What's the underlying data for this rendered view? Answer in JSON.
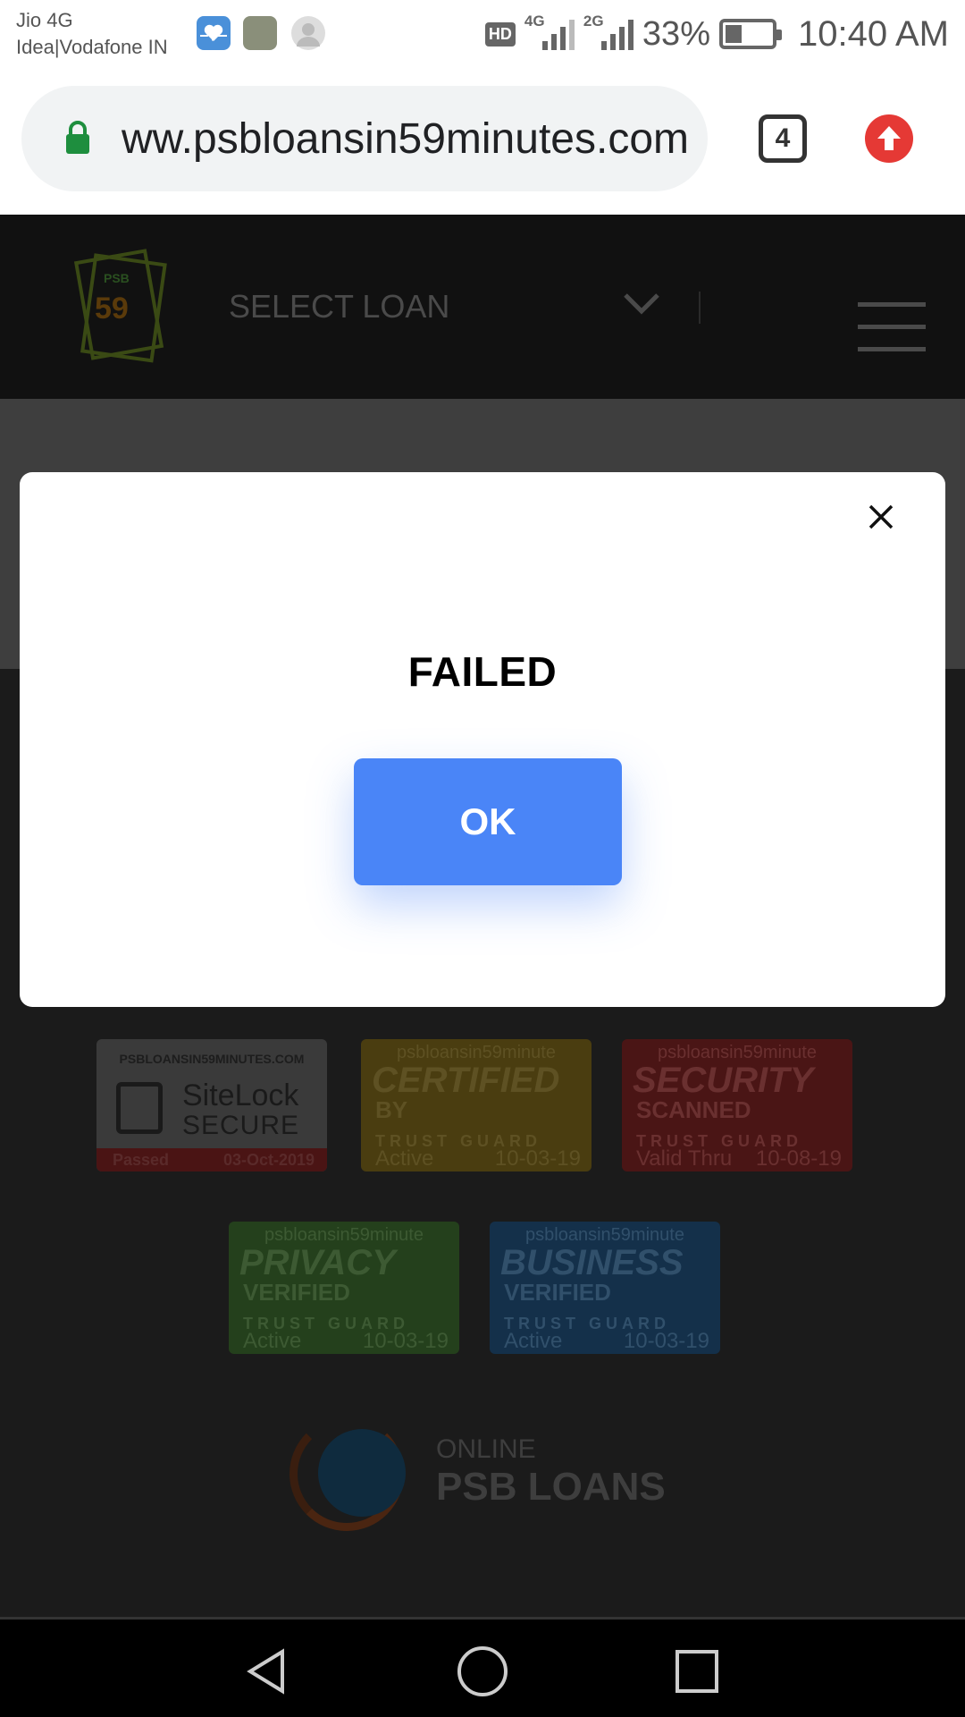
{
  "status_bar": {
    "carrier_1": "Jio 4G",
    "carrier_2": "Idea|Vodafone IN",
    "hd": "HD",
    "net_1": "4G",
    "net_2": "2G",
    "battery": "33%",
    "time": "10:40 AM"
  },
  "browser": {
    "url": "ww.psbloansin59minutes.com",
    "tab_count": "4"
  },
  "site": {
    "logo_text_small": "PSB",
    "logo_text_big": "59",
    "select_loan": "SELECT LOAN",
    "badges": {
      "sitelock": {
        "header": "PSBLOANSIN59MINUTES.COM",
        "line1": "SiteLock",
        "line2": "SECURE",
        "status": "Passed",
        "date": "03-Oct-2019"
      },
      "certified": {
        "top": "psbloansin59minute",
        "big": "CERTIFIED",
        "mid": "BY",
        "tg": "TRUST GUARD",
        "status": "Active",
        "date": "10-03-19"
      },
      "security": {
        "top": "psbloansin59minute",
        "big": "SECURITY",
        "mid": "SCANNED",
        "tg": "TRUST GUARD",
        "status": "Valid Thru",
        "date": "10-08-19"
      },
      "privacy": {
        "top": "psbloansin59minute",
        "big": "PRIVACY",
        "mid": "VERIFIED",
        "tg": "TRUST GUARD",
        "status": "Active",
        "date": "10-03-19"
      },
      "business": {
        "top": "psbloansin59minute",
        "big": "BUSINESS",
        "mid": "VERIFIED",
        "tg": "TRUST GUARD",
        "status": "Active",
        "date": "10-03-19"
      }
    },
    "footer_logo_online": "ONLINE",
    "footer_logo_name": "PSB LOANS"
  },
  "dialog": {
    "title": "FAILED",
    "ok_label": "OK"
  },
  "colors": {
    "ok_button": "#4a85f7",
    "update_badge": "#e53935",
    "lock": "#1e8e3e"
  }
}
